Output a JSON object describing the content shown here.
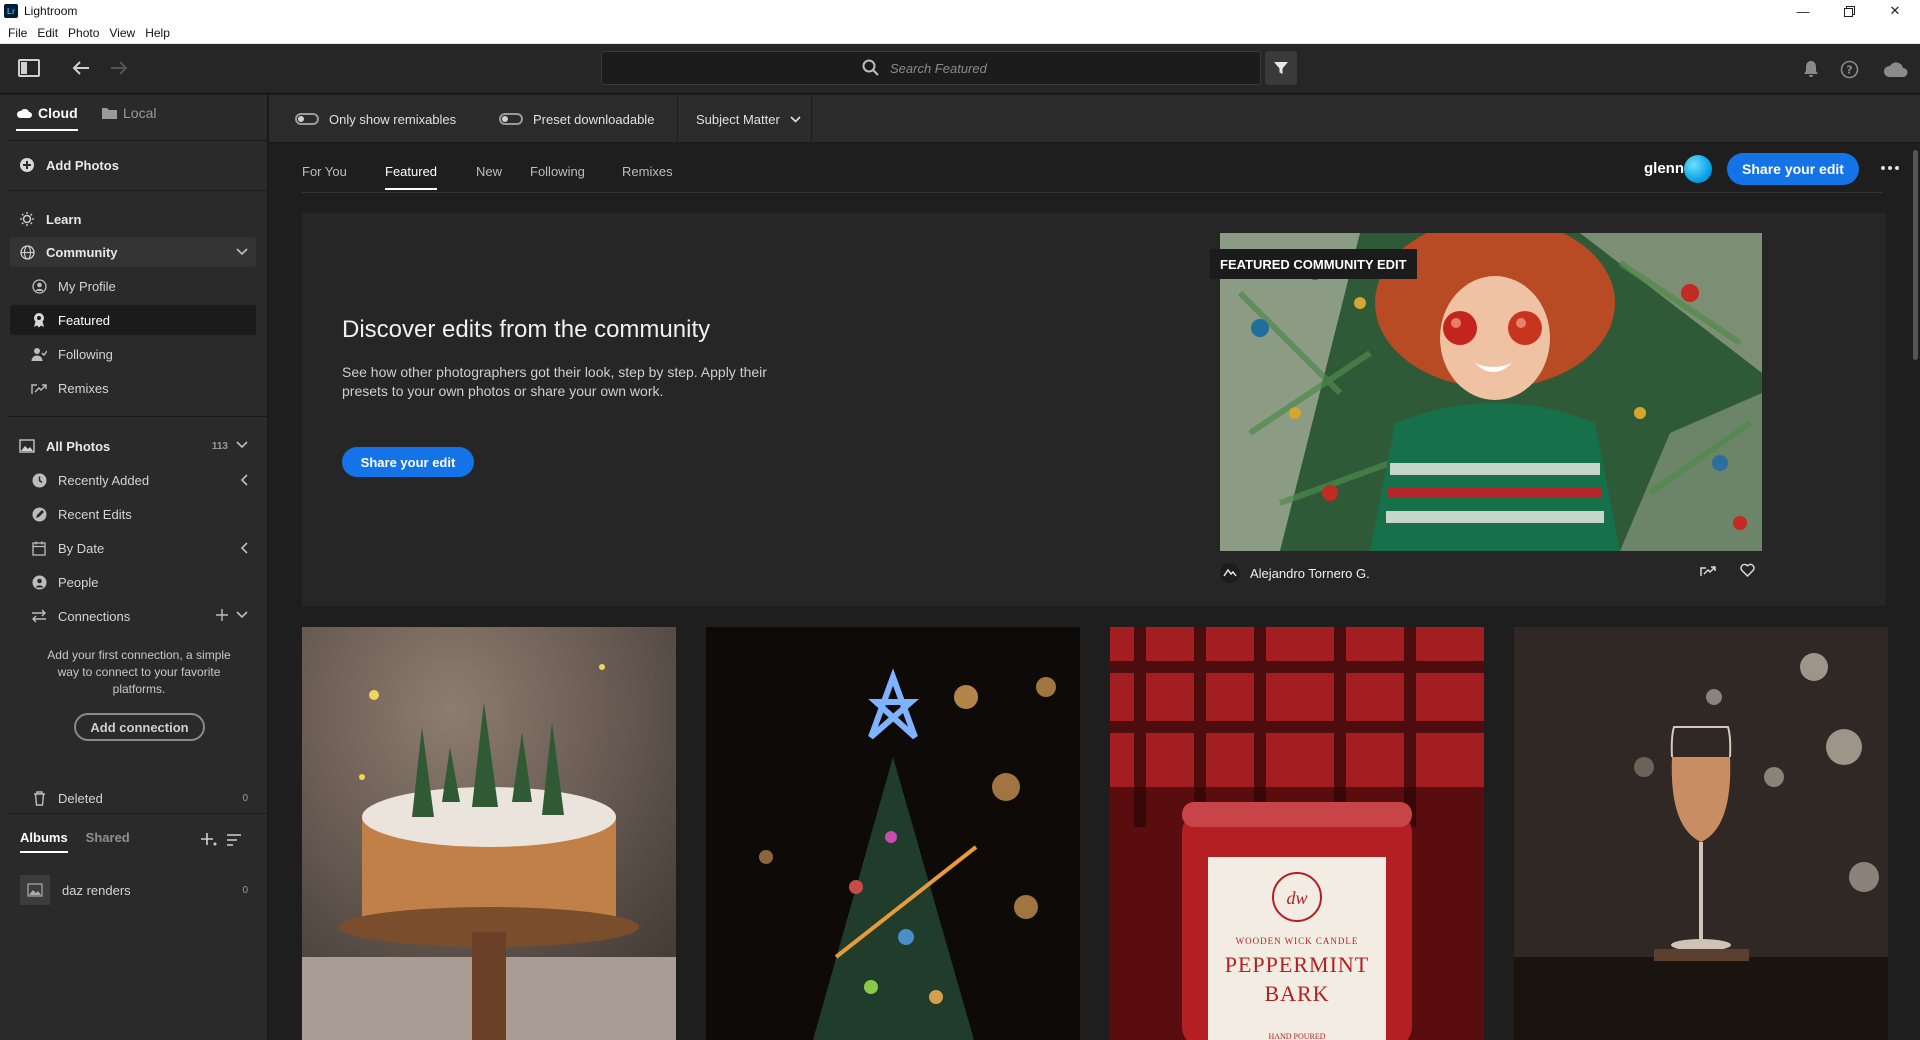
{
  "window": {
    "title": "Lightroom",
    "app_icon_text": "Lr"
  },
  "menu": [
    "File",
    "Edit",
    "Photo",
    "View",
    "Help"
  ],
  "search": {
    "placeholder": "Search Featured"
  },
  "sidebar": {
    "tabs": {
      "cloud": "Cloud",
      "local": "Local"
    },
    "add_photos": "Add Photos",
    "learn": "Learn",
    "community": "Community",
    "community_items": [
      "My Profile",
      "Featured",
      "Following",
      "Remixes"
    ],
    "all_photos": {
      "label": "All Photos",
      "count": "113"
    },
    "photo_items": [
      "Recently Added",
      "Recent Edits",
      "By Date",
      "People"
    ],
    "connections": "Connections",
    "connection_hint": "Add your first connection, a simple way to connect to your favorite platforms.",
    "add_connection": "Add connection",
    "deleted": {
      "label": "Deleted",
      "count": "0"
    },
    "albums_tabs": {
      "albums": "Albums",
      "shared": "Shared"
    },
    "albums": [
      {
        "label": "daz renders",
        "count": "0"
      }
    ]
  },
  "filters": {
    "remixables": "Only show remixables",
    "preset": "Preset downloadable",
    "subject": "Subject Matter"
  },
  "tabs": [
    "For You",
    "Featured",
    "New",
    "Following",
    "Remixes"
  ],
  "user": {
    "name": "glenn"
  },
  "share_edit": "Share your edit",
  "hero": {
    "title": "Discover edits from the community",
    "description": "See how other photographers got their look, step by step. Apply their presets to your own photos or share your own work.",
    "button": "Share your edit",
    "badge": "FEATURED COMMUNITY EDIT",
    "author": "Alejandro Tornero G."
  },
  "grid": {
    "candle_brand": "WOODEN WICK CANDLE",
    "candle_name1": "PEPPERMINT",
    "candle_name2": "BARK",
    "candle_small": "HAND POURED"
  },
  "colors": {
    "accent": "#1473e6",
    "background": "#1e1e1e",
    "panel": "#2a2a2a"
  }
}
